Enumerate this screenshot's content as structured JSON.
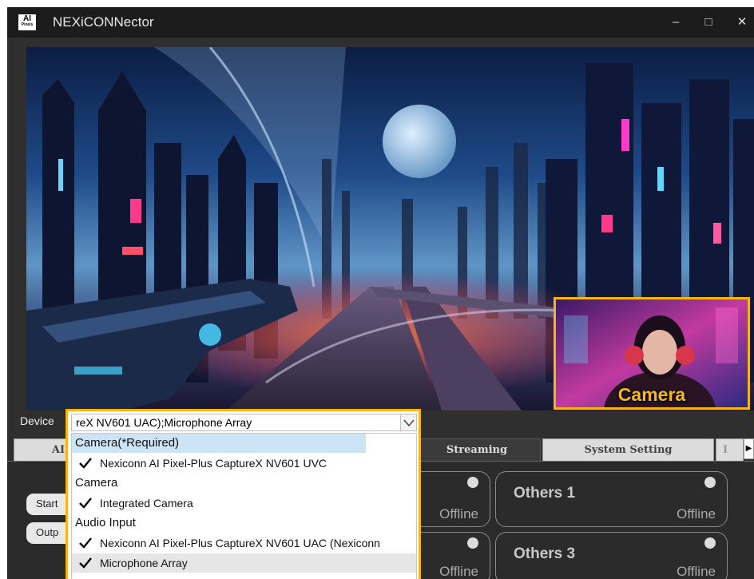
{
  "window": {
    "title": "NEXiCONNector",
    "logo_big": "AI",
    "logo_small": "Pixels",
    "minimize": "–",
    "maximize": "□",
    "close": "✕"
  },
  "preview": {
    "camera_label": "Camera"
  },
  "device": {
    "label": "Device",
    "value": "reX NV601 UAC);Microphone Array",
    "options": [
      {
        "kind": "group",
        "label": "Camera(*Required)",
        "highlighted": true
      },
      {
        "kind": "item",
        "label": "Nexiconn AI Pixel-Plus CaptureX NV601 UVC",
        "checked": true
      },
      {
        "kind": "group",
        "label": "Camera",
        "highlighted": false
      },
      {
        "kind": "item",
        "label": "Integrated Camera",
        "checked": true
      },
      {
        "kind": "group",
        "label": "Audio Input",
        "highlighted": false
      },
      {
        "kind": "item",
        "label": "Nexiconn AI Pixel-Plus CaptureX NV601 UAC (Nexiconn",
        "checked": true
      },
      {
        "kind": "item",
        "label": "Microphone Array",
        "checked": true,
        "selected": true
      }
    ]
  },
  "tabs": [
    {
      "label": "AI",
      "active": false
    },
    {
      "label": "Streaming",
      "active": true
    },
    {
      "label": "System Setting",
      "active": false
    },
    {
      "label": "I",
      "active": false
    }
  ],
  "buttons": {
    "start": "Start",
    "output": "Outp"
  },
  "cards": [
    {
      "name": "",
      "status": "Offline"
    },
    {
      "name": "Others 1",
      "status": "Offline"
    },
    {
      "name": "",
      "status": "Offline"
    },
    {
      "name": "Others 3",
      "status": "Offline"
    }
  ],
  "colors": {
    "highlight_border": "#f4b515",
    "window_bg": "#2f2f2f",
    "titlebar_bg": "#1c1c1c",
    "selection_bg": "#cde4f7"
  },
  "icons": {
    "dropdown": "chevron-down-icon",
    "tab_scroll": "triangle-right-icon",
    "option_check": "checkmark-icon"
  }
}
